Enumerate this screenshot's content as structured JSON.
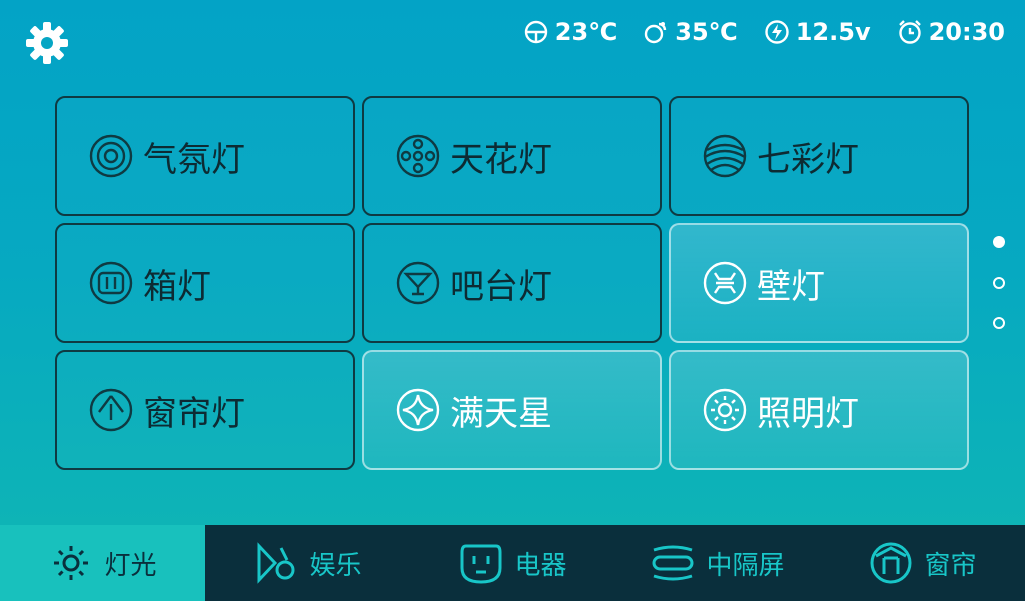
{
  "status": {
    "indoor_temp": "23℃",
    "outdoor_temp": "35℃",
    "voltage": "12.5v",
    "time": "20:30"
  },
  "tiles": [
    {
      "label": "气氛灯",
      "icon": "ambient-light-icon",
      "active": false
    },
    {
      "label": "天花灯",
      "icon": "ceiling-light-icon",
      "active": false
    },
    {
      "label": "七彩灯",
      "icon": "rainbow-light-icon",
      "active": false
    },
    {
      "label": "箱灯",
      "icon": "box-light-icon",
      "active": false
    },
    {
      "label": "吧台灯",
      "icon": "bar-light-icon",
      "active": false
    },
    {
      "label": "壁灯",
      "icon": "wall-light-icon",
      "active": true
    },
    {
      "label": "窗帘灯",
      "icon": "curtain-light-icon",
      "active": false
    },
    {
      "label": "满天星",
      "icon": "starry-light-icon",
      "active": true
    },
    {
      "label": "照明灯",
      "icon": "illumination-light-icon",
      "active": true
    }
  ],
  "pager": {
    "pages": 3,
    "current": 1
  },
  "nav": [
    {
      "label": "灯光",
      "icon": "sun-icon",
      "active": true
    },
    {
      "label": "娱乐",
      "icon": "music-icon",
      "active": false
    },
    {
      "label": "电器",
      "icon": "socket-icon",
      "active": false
    },
    {
      "label": "中隔屏",
      "icon": "partition-screen-icon",
      "active": false
    },
    {
      "label": "窗帘",
      "icon": "curtain-icon",
      "active": false
    }
  ],
  "colors": {
    "accent": "#18c1bd",
    "nav_bg": "#0a2f3c",
    "tile_border": "#0f3a42"
  }
}
